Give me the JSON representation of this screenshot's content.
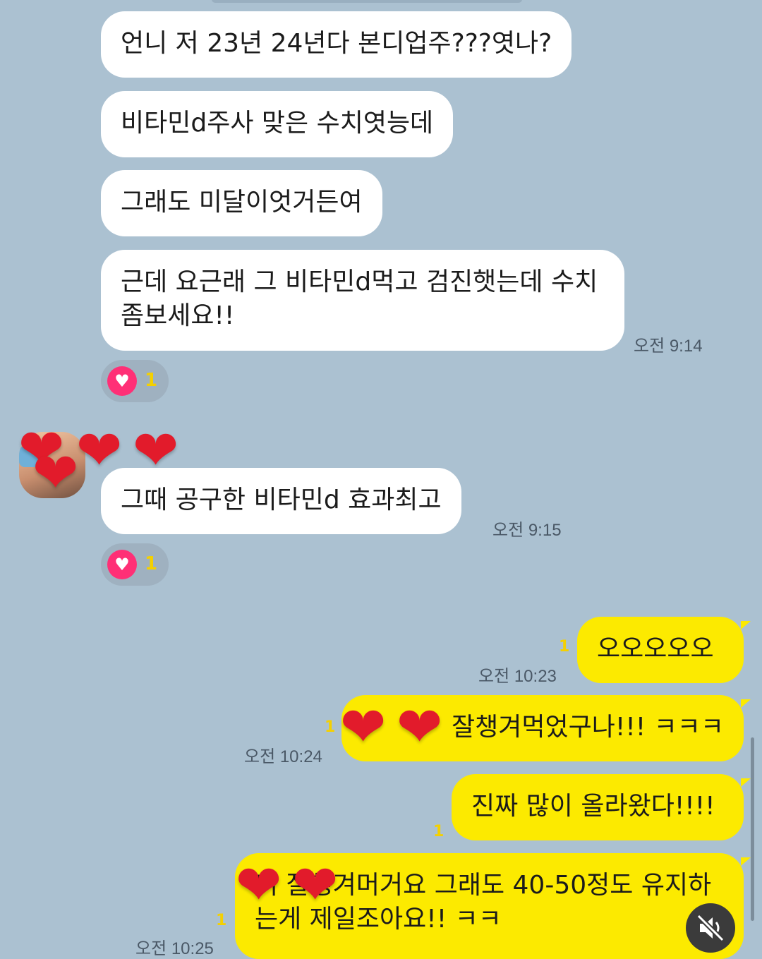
{
  "messages_in": [
    {
      "text": "언니 저 23년 24년다 본디업주???엿나?"
    },
    {
      "text": "비타민d주사 맞은 수치엿능데"
    },
    {
      "text": "그래도 미달이엇거든여"
    },
    {
      "text": "근데 요근래 그 비타민d먹고 검진햇는데 수치좀보세요!!",
      "time": "오전 9:14"
    },
    {
      "text": "그때 공구한 비타민d 효과최고",
      "time": "오전 9:15"
    }
  ],
  "reactions": [
    {
      "icon": "heart-icon",
      "count": "1"
    },
    {
      "icon": "heart-icon",
      "count": "1"
    }
  ],
  "messages_out": [
    {
      "text": "오오오오오",
      "time": "오전 10:23",
      "unread": "1"
    },
    {
      "text": "잘챙겨먹었구나!!! ㅋㅋㅋ",
      "time": "오전 10:24",
      "unread": "1"
    },
    {
      "text": "진짜 많이 올라왔다!!!!",
      "unread": "1"
    },
    {
      "text": "더 잘챙겨머거요 그래도 40-50정도 유지하는게 제일조아요!! ㅋㅋ",
      "time": "오전 10:25",
      "unread": "1"
    }
  ],
  "overlay": {
    "heart_glyph": "❤",
    "mute_icon": "speaker-muted-icon"
  },
  "colors": {
    "background": "#abc1d1",
    "incoming": "#ffffff",
    "outgoing": "#fcea00",
    "heart": "#e21b2b",
    "reaction": "#ff2f76"
  }
}
